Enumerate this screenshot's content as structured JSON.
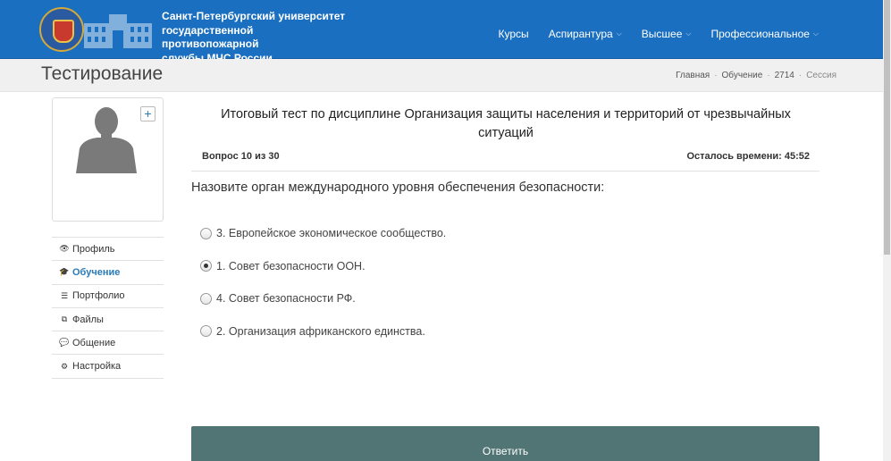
{
  "header": {
    "brand_line1": "Санкт-Петербургский университет",
    "brand_line2": "государственной противопожарной",
    "brand_line3": "службы МЧС России",
    "nav": [
      {
        "label": "Курсы",
        "dropdown": false
      },
      {
        "label": "Аспирантура",
        "dropdown": true
      },
      {
        "label": "Высшее",
        "dropdown": true
      },
      {
        "label": "Профессиональное",
        "dropdown": true
      }
    ]
  },
  "subheader": {
    "title": "Тестирование",
    "breadcrumbs": [
      "Главная",
      "Обучение",
      "2714",
      "Сессия"
    ],
    "separator": "·"
  },
  "sidebar": {
    "add_photo_label": "+",
    "items": [
      {
        "label": "Профиль",
        "icon": "eye-icon",
        "glyph": "👁",
        "active": false
      },
      {
        "label": "Обучение",
        "icon": "graduation-cap-icon",
        "glyph": "🎓",
        "active": true
      },
      {
        "label": "Портфолио",
        "icon": "list-icon",
        "glyph": "☰",
        "active": false
      },
      {
        "label": "Файлы",
        "icon": "files-icon",
        "glyph": "⧉",
        "active": false
      },
      {
        "label": "Общение",
        "icon": "chat-icon",
        "glyph": "💬",
        "active": false
      },
      {
        "label": "Настройка",
        "icon": "gears-icon",
        "glyph": "⚙",
        "active": false
      }
    ]
  },
  "test": {
    "title": "Итоговый тест по дисциплине Организация защиты населения и территорий от чрезвычайных ситуаций",
    "progress": "Вопрос 10 из 30",
    "timer": "Осталось времени: 45:52",
    "question": "Назовите орган международного уровня обеспечения безопасности:",
    "answers": [
      {
        "label": "3. Европейское экономическое сообщество.",
        "selected": false
      },
      {
        "label": "1. Совет безопасности ООН.",
        "selected": true
      },
      {
        "label": "4. Совет безопасности РФ.",
        "selected": false
      },
      {
        "label": "2. Организация африканского единства.",
        "selected": false
      }
    ],
    "submit_label": "Ответить"
  },
  "colors": {
    "header_bg": "#1a6fc0",
    "active_link": "#2a7ab8",
    "submit_bg": "#517474"
  }
}
